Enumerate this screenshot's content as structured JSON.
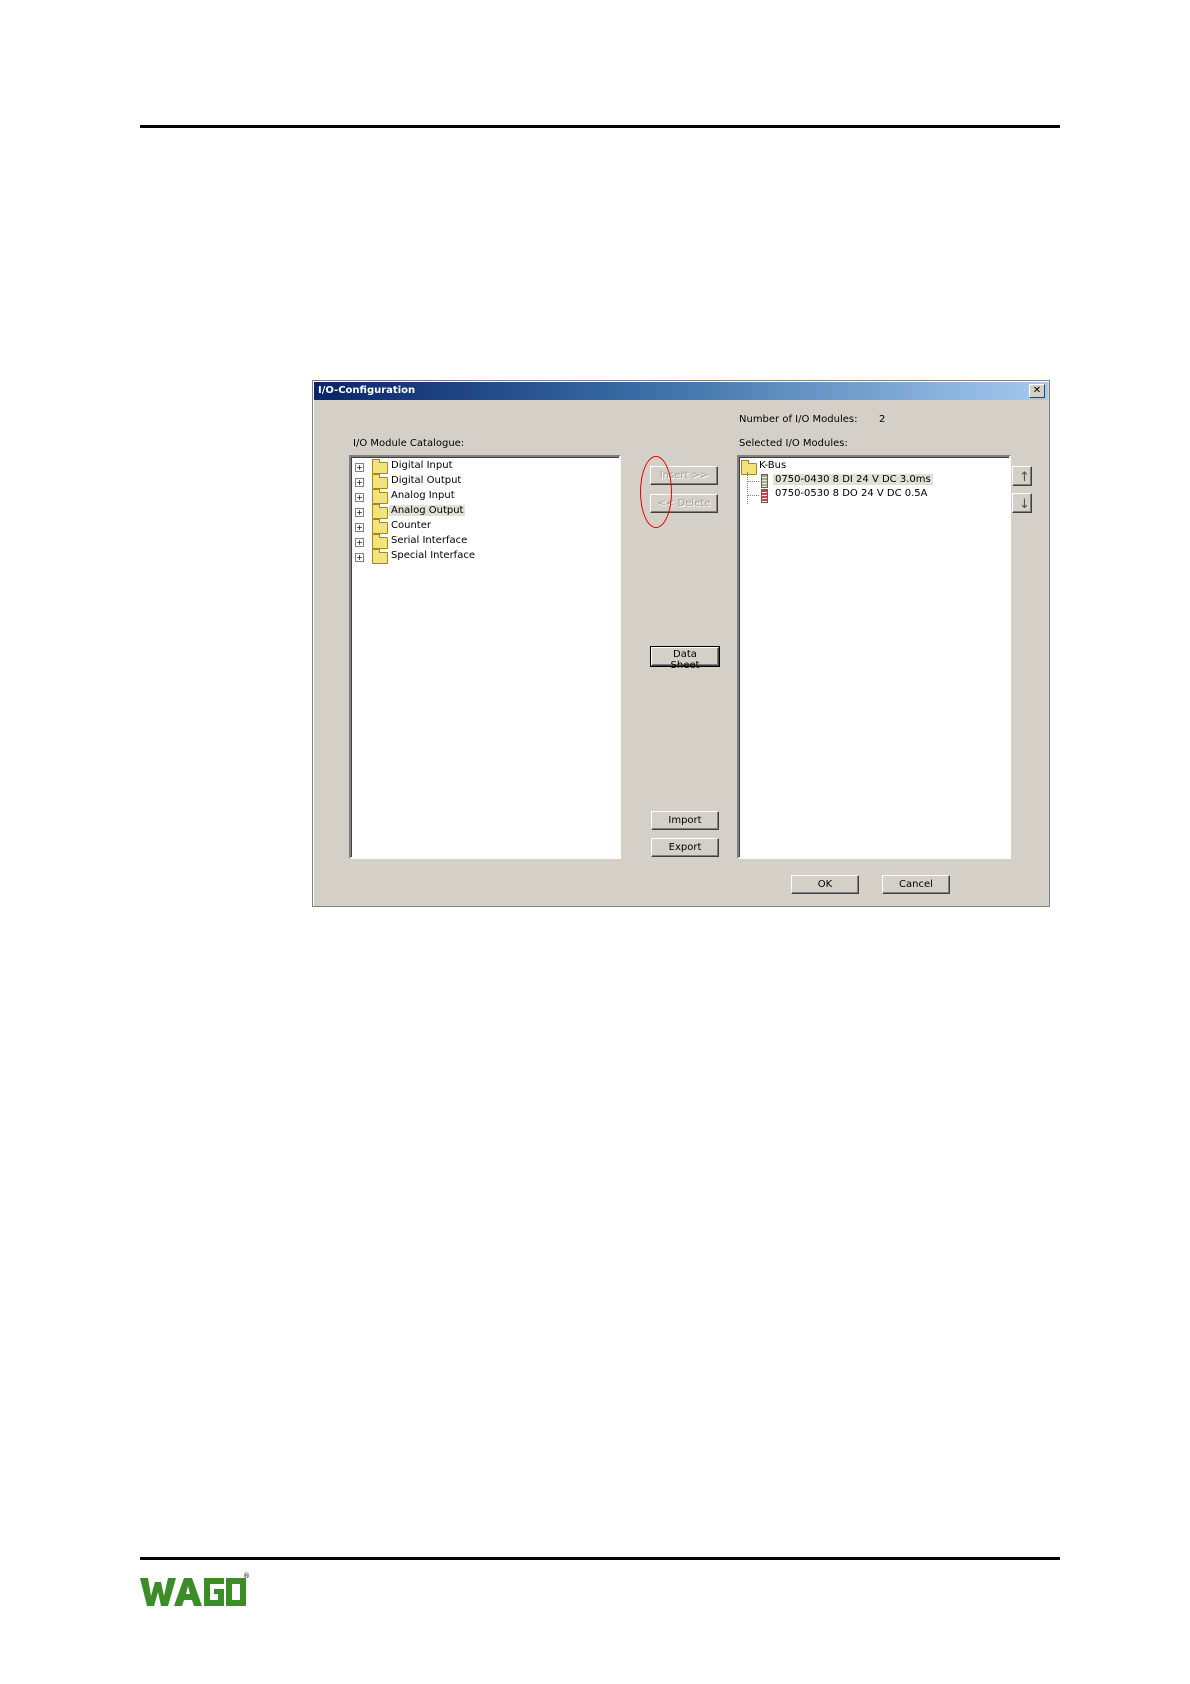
{
  "dialog": {
    "title": "I/O-Configuration",
    "close_glyph": "✕",
    "number_label": "Number of I/O Modules:",
    "number_value": "2",
    "catalogue_label": "I/O Module Catalogue:",
    "selected_label": "Selected I/O Modules:"
  },
  "catalogue": [
    {
      "label": "Digital Input",
      "icon": "folder-icon"
    },
    {
      "label": "Digital Output",
      "icon": "folder-icon"
    },
    {
      "label": "Analog Input",
      "icon": "folder-icon"
    },
    {
      "label": "Analog Output",
      "icon": "folder-icon",
      "selected": true
    },
    {
      "label": "Counter",
      "icon": "folder-icon"
    },
    {
      "label": "Serial Interface",
      "icon": "folder-icon"
    },
    {
      "label": "Special Interface",
      "icon": "folder-icon"
    }
  ],
  "selected": {
    "root": "K-Bus",
    "modules": [
      {
        "label": "0750-0430  8 DI 24 V DC 3.0ms",
        "highlighted": true
      },
      {
        "label": "0750-0530  8 DO 24 V DC 0.5A",
        "highlighted": false
      }
    ]
  },
  "buttons": {
    "insert": "Insert >>",
    "delete": "<< Delete",
    "data_sheet": "Data Sheet",
    "import": "Import",
    "export": "Export",
    "ok": "OK",
    "cancel": "Cancel",
    "move_up": "↑",
    "move_down": "↓"
  },
  "expander_glyph": "+",
  "footer": {
    "logo_text": "WAGO",
    "logo_mark": "®",
    "logo_color": "#3c8c28"
  },
  "highlight_color": "#e00000"
}
